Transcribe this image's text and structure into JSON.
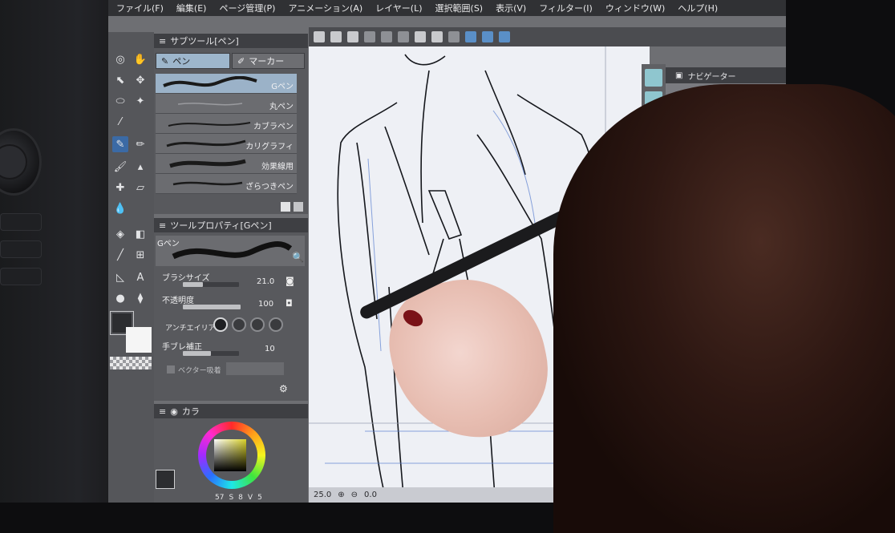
{
  "menubar": {
    "items": [
      "ファイル(F)",
      "編集(E)",
      "ページ管理(P)",
      "アニメーション(A)",
      "レイヤー(L)",
      "選択範囲(S)",
      "表示(V)",
      "フィルター(I)",
      "ウィンドウ(W)",
      "ヘルプ(H)"
    ]
  },
  "subtool": {
    "title": "サブツール[ペン]",
    "tabs": [
      "ペン",
      "マーカー"
    ],
    "brushes": [
      "Gペン",
      "丸ペン",
      "カブラペン",
      "カリグラフィ",
      "効果線用",
      "ざらつきペン"
    ],
    "selected": "Gペン"
  },
  "toolprop": {
    "title": "ツールプロパティ[Gペン]",
    "preview_label": "Gペン",
    "brush_size_label": "ブラシサイズ",
    "brush_size_value": "21.0",
    "brush_size_fill": 0.35,
    "opacity_label": "不透明度",
    "opacity_value": "100",
    "opacity_fill": 1.0,
    "antialias_label": "アンチエイリアス",
    "stabilization_label": "手ブレ補正",
    "stabilization_value": "10",
    "stabilization_fill": 0.5,
    "vector_label": "ベクター吸着"
  },
  "color": {
    "title": "カラ",
    "main_color": "#2c2d30",
    "sub_color": "#f5f5f5",
    "readout": [
      "57",
      "S",
      "8",
      "V",
      "5"
    ]
  },
  "navigator": {
    "title": "ナビゲーター"
  },
  "canvas": {
    "zoom": "25.0",
    "angle": "0.0",
    "paper_color": "#eef0f5"
  }
}
